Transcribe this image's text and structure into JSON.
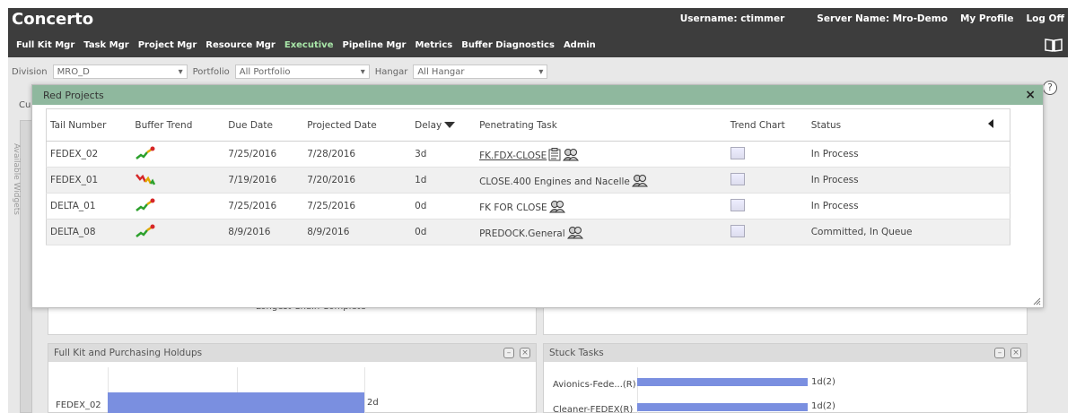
{
  "app": {
    "title": "Concerto",
    "username_label": "Username: ctimmer",
    "server_label": "Server Name: Mro-Demo",
    "profile_link": "My Profile",
    "logoff_link": "Log Off"
  },
  "nav": [
    {
      "label": "Full Kit Mgr",
      "active": false
    },
    {
      "label": "Task Mgr",
      "active": false
    },
    {
      "label": "Project Mgr",
      "active": false
    },
    {
      "label": "Resource Mgr",
      "active": false
    },
    {
      "label": "Executive",
      "active": true
    },
    {
      "label": "Pipeline Mgr",
      "active": false
    },
    {
      "label": "Metrics",
      "active": false
    },
    {
      "label": "Buffer Diagnostics",
      "active": false
    },
    {
      "label": "Admin",
      "active": false
    }
  ],
  "filters": {
    "division_label": "Division",
    "division_value": "MRO_D",
    "portfolio_label": "Portfolio",
    "portfolio_value": "All Portfolio",
    "hangar_label": "Hangar",
    "hangar_value": "All Hangar"
  },
  "background": {
    "cu_label": "Cu",
    "side_tab_label": "Available Widgets",
    "chart_caption": "Longest Chain Complete",
    "help_glyph": "?"
  },
  "widgets": {
    "fullkit": {
      "title": "Full Kit and Purchasing Holdups",
      "row_label": "FEDEX_02",
      "row_value": "2d"
    },
    "stuck": {
      "title": "Stuck Tasks",
      "row1_label": "Avionics-Fede...(R)",
      "row1_value": "1d(2)",
      "row2_label": "Cleaner-FEDEX(R)",
      "row2_value": "1d(2)"
    }
  },
  "modal": {
    "title": "Red Projects",
    "close_glyph": "×",
    "columns": {
      "tail": "Tail Number",
      "buffer": "Buffer Trend",
      "due": "Due Date",
      "projected": "Projected Date",
      "delay": "Delay",
      "task": "Penetrating Task",
      "trend": "Trend Chart",
      "status": "Status"
    },
    "rows": [
      {
        "tail": "FEDEX_02",
        "due": "7/25/2016",
        "projected": "7/28/2016",
        "delay": "3d",
        "task": "FK.FDX-CLOSE",
        "status": "In Process"
      },
      {
        "tail": "FEDEX_01",
        "due": "7/19/2016",
        "projected": "7/20/2016",
        "delay": "1d",
        "task": "CLOSE.400 Engines and Nacelle",
        "status": "In Process"
      },
      {
        "tail": "DELTA_01",
        "due": "7/25/2016",
        "projected": "7/25/2016",
        "delay": "0d",
        "task": "FK FOR CLOSE",
        "status": "In Process"
      },
      {
        "tail": "DELTA_08",
        "due": "8/9/2016",
        "projected": "8/9/2016",
        "delay": "0d",
        "task": "PREDOCK.General",
        "status": "Committed, In Queue"
      }
    ]
  },
  "colors": {
    "header_bg": "#3d3d3d",
    "modal_head": "#8fb89e",
    "bar_fill": "#7a8fe0",
    "active_nav": "#a8e6a8"
  }
}
